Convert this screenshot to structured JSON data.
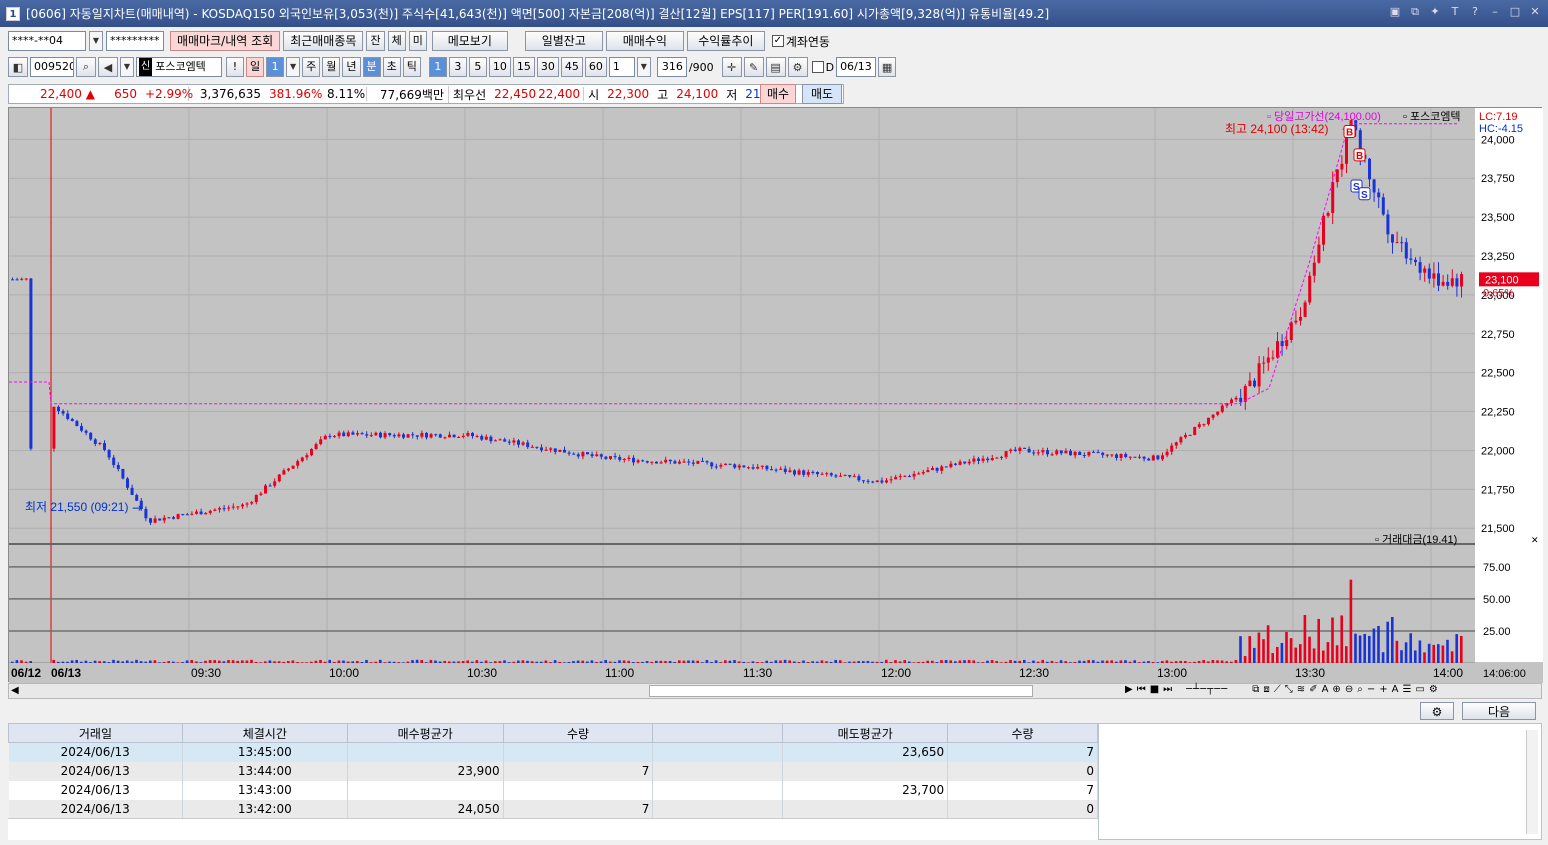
{
  "window": {
    "title": "[0606] 자동일지차트(매매내역) - KOSDAQ150 외국인보유[3,053(천)] 주식수[41,643(천)] 액면[500] 자본금[208(억)] 결산[12월] EPS[117] PER[191.60] 시가총액[9,328(억)] 유통비율[49.2]",
    "icon_text": "1"
  },
  "toolbar1": {
    "account": "****-**04",
    "password": "*********",
    "btn_marks": "매매마크/내역 조회",
    "btn_recent": "최근매매종목",
    "btn_jan": "잔",
    "btn_che": "체",
    "btn_mi": "미",
    "btn_memo": "메모보기",
    "btn_daily": "일별잔고",
    "btn_profit": "매매수익",
    "btn_ratio": "수익률추이",
    "chk_account": "계좌연동"
  },
  "toolbar2": {
    "code": "009520",
    "stock_badge": "신",
    "stock_name": "포스코엠텍",
    "excl": "!",
    "period_day": "일",
    "period_num": "1",
    "period_week": "주",
    "period_month": "월",
    "period_year": "년",
    "period_min": "분",
    "period_sec": "초",
    "period_tick": "틱",
    "min_opts": [
      "1",
      "3",
      "5",
      "10",
      "15",
      "30",
      "45",
      "60"
    ],
    "min_custom": "1",
    "count": "316",
    "count_max": "/900",
    "chk_d": "D",
    "date": "06/13"
  },
  "quote": {
    "price": "22,400",
    "arrow": "▲",
    "change": "650",
    "rate": "+2.99%",
    "volume": "3,376,635",
    "vol_rate": "381.96%",
    "turnover": "8.11%",
    "amount": "77,669백만",
    "bid_label": "최우선",
    "bid1": "22,450",
    "bid2": "22,400",
    "open_label": "시",
    "open": "22,300",
    "high_label": "고",
    "high": "24,100",
    "low_label": "저",
    "low": "21,550",
    "buy": "매수",
    "sell": "매도"
  },
  "chart": {
    "legend_highline": "당일고가선(24,100.00)",
    "legend_stock": "포스코엠텍",
    "lc": "LC:7.19",
    "hc": "HC:-4.15",
    "high_annot": "최고 24,100 (13:42)",
    "low_annot": "최저 21,550 (09:21)",
    "price_ticks": [
      "24,000",
      "23,750",
      "23,500",
      "23,250",
      "23,000",
      "22,750",
      "22,500",
      "22,250",
      "22,000",
      "21,750",
      "21,500"
    ],
    "current_price": "23,100",
    "current_pct": "0.65%",
    "vol_legend": "거래대금(19.41)",
    "vol_ticks": [
      "75.00",
      "50.00",
      "25.00"
    ],
    "time_labels": [
      "06/12",
      "06/13",
      "09:30",
      "10:00",
      "10:30",
      "11:00",
      "11:30",
      "12:00",
      "12:30",
      "13:00",
      "13:30",
      "14:00"
    ],
    "time_right": "14:06:00",
    "marks": [
      "B",
      "B",
      "S",
      "S"
    ],
    "colors": {
      "up": "#e8001c",
      "down": "#1a33d6",
      "line": "#ff00ff",
      "bg": "#c3c3c3"
    }
  },
  "chart_data": {
    "type": "candlestick",
    "x_unit": "time (minute)",
    "y_range": [
      21450,
      24150
    ],
    "session_high": 24100,
    "session_low": 21550,
    "series_close_approx": [
      {
        "t": "06/12 last",
        "p": 22000
      },
      {
        "t": "09:00",
        "p": 22300
      },
      {
        "t": "09:10",
        "p": 22000
      },
      {
        "t": "09:21",
        "p": 21550
      },
      {
        "t": "09:40",
        "p": 21650
      },
      {
        "t": "10:00",
        "p": 22100
      },
      {
        "t": "10:30",
        "p": 22100
      },
      {
        "t": "11:00",
        "p": 21950
      },
      {
        "t": "11:30",
        "p": 21900
      },
      {
        "t": "12:00",
        "p": 21800
      },
      {
        "t": "12:30",
        "p": 22000
      },
      {
        "t": "13:00",
        "p": 21950
      },
      {
        "t": "13:20",
        "p": 22400
      },
      {
        "t": "13:30",
        "p": 22900
      },
      {
        "t": "13:42",
        "p": 24100
      },
      {
        "t": "13:50",
        "p": 23400
      },
      {
        "t": "14:00",
        "p": 23100
      },
      {
        "t": "14:06",
        "p": 23100
      }
    ],
    "volume_peak": {
      "t": "13:42",
      "v": 65
    }
  },
  "bottom": {
    "btn_next": "다음"
  },
  "table": {
    "headers": [
      "거래일",
      "체결시간",
      "매수평균가",
      "수량",
      "",
      "매도평균가",
      "수량"
    ],
    "rows": [
      [
        "2024/06/13",
        "13:45:00",
        "",
        "",
        "",
        "23,650",
        "7"
      ],
      [
        "2024/06/13",
        "13:44:00",
        "23,900",
        "7",
        "",
        "",
        "0"
      ],
      [
        "2024/06/13",
        "13:43:00",
        "",
        "",
        "",
        "23,700",
        "7"
      ],
      [
        "2024/06/13",
        "13:42:00",
        "24,050",
        "7",
        "",
        "",
        "0"
      ]
    ]
  }
}
